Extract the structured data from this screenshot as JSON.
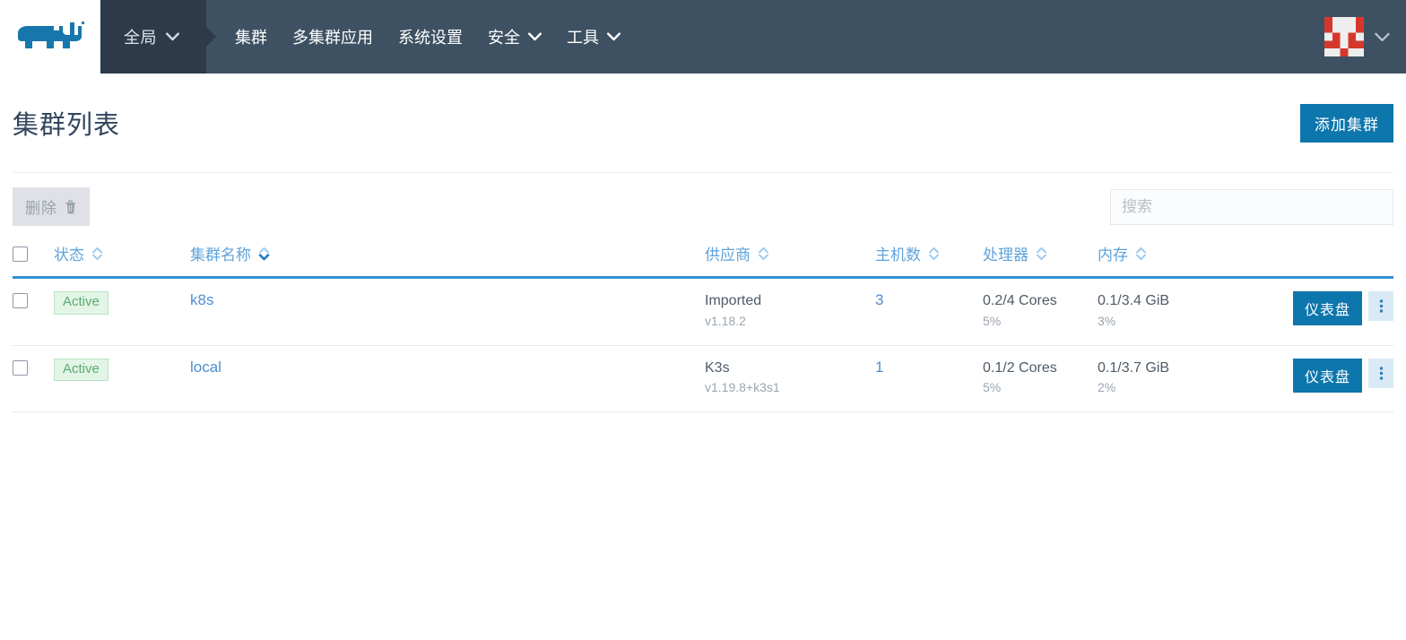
{
  "colors": {
    "navbar_bg": "#3d5162",
    "navbar_scope_bg": "#2c3a49",
    "accent_blue": "#0d76ad",
    "link_blue": "#4e8fd0",
    "header_blue": "#5fa3dc",
    "header_rule_blue": "#3191d4",
    "title_navy": "#30455c",
    "badge_green_text": "#5aab72",
    "badge_green_bg": "#e2f5e6",
    "disabled_bg": "#dfe1e6",
    "disabled_text": "#9aa3ad",
    "logo_blue": "#1777ac",
    "identicon_red": "#d5382a",
    "identicon_light": "#eeeeee"
  },
  "navbar": {
    "logo_icon": "rancher-cow-logo-icon",
    "scope": {
      "label": "全局",
      "icon": "chevron-down-icon"
    },
    "links": [
      {
        "label": "集群",
        "icon": null
      },
      {
        "label": "多集群应用",
        "icon": null
      },
      {
        "label": "系统设置",
        "icon": null
      },
      {
        "label": "安全",
        "icon": "chevron-down-icon"
      },
      {
        "label": "工具",
        "icon": "chevron-down-icon"
      }
    ],
    "user": {
      "avatar_icon": "identicon-avatar",
      "icon": "chevron-down-icon"
    }
  },
  "page": {
    "title": "集群列表",
    "add_button": {
      "label": "添加集群"
    }
  },
  "toolbar": {
    "delete_button": {
      "label": "删除",
      "icon": "trash-icon",
      "disabled": true
    },
    "search": {
      "value": "",
      "placeholder": "搜索"
    }
  },
  "table": {
    "select_all": {
      "checked": false
    },
    "columns": [
      {
        "key": "state",
        "label": "状态",
        "sortable": true,
        "sort": "none"
      },
      {
        "key": "name",
        "label": "集群名称",
        "sortable": true,
        "sort": "asc"
      },
      {
        "key": "provider",
        "label": "供应商",
        "sortable": true,
        "sort": "none"
      },
      {
        "key": "hosts",
        "label": "主机数",
        "sortable": true,
        "sort": "none"
      },
      {
        "key": "cpu",
        "label": "处理器",
        "sortable": true,
        "sort": "none"
      },
      {
        "key": "memory",
        "label": "内存",
        "sortable": true,
        "sort": "none"
      }
    ],
    "rows": [
      {
        "checked": false,
        "state": "Active",
        "name": "k8s",
        "provider": "Imported",
        "provider_version": "v1.18.2",
        "hosts": "3",
        "cpu": "0.2/4 Cores",
        "cpu_pct": "5%",
        "memory": "0.1/3.4 GiB",
        "memory_pct": "3%",
        "dashboard_label": "仪表盘",
        "menu_icon": "kebab-menu-icon"
      },
      {
        "checked": false,
        "state": "Active",
        "name": "local",
        "provider": "K3s",
        "provider_version": "v1.19.8+k3s1",
        "hosts": "1",
        "cpu": "0.1/2 Cores",
        "cpu_pct": "5%",
        "memory": "0.1/3.7 GiB",
        "memory_pct": "2%",
        "dashboard_label": "仪表盘",
        "menu_icon": "kebab-menu-icon"
      }
    ]
  }
}
